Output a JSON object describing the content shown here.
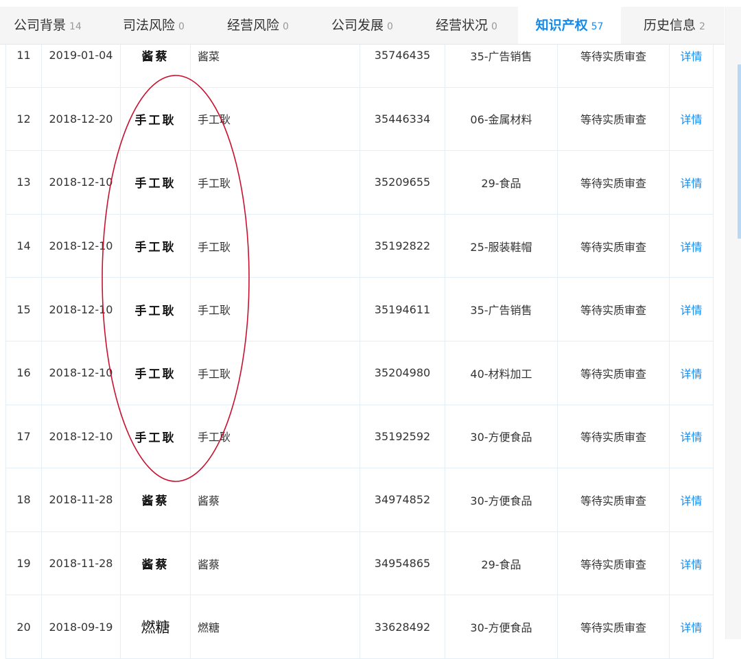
{
  "tabs": [
    {
      "label": "公司背景",
      "count": "14",
      "active": false
    },
    {
      "label": "司法风险",
      "count": "0",
      "active": false
    },
    {
      "label": "经营风险",
      "count": "0",
      "active": false
    },
    {
      "label": "公司发展",
      "count": "0",
      "active": false
    },
    {
      "label": "经营状况",
      "count": "0",
      "active": false
    },
    {
      "label": "知识产权",
      "count": "57",
      "active": true
    },
    {
      "label": "历史信息",
      "count": "2",
      "active": false
    }
  ],
  "rows": [
    {
      "no": "11",
      "date": "2019-01-04",
      "logo": "酱蔡",
      "name": "酱菜",
      "reg_no": "35746435",
      "category": "35-广告销售",
      "status": "等待实质审查",
      "link": "详情"
    },
    {
      "no": "12",
      "date": "2018-12-20",
      "logo": "手工耿",
      "name": "手工耿",
      "reg_no": "35446334",
      "category": "06-金属材料",
      "status": "等待实质审查",
      "link": "详情"
    },
    {
      "no": "13",
      "date": "2018-12-10",
      "logo": "手工耿",
      "name": "手工耿",
      "reg_no": "35209655",
      "category": "29-食品",
      "status": "等待实质审查",
      "link": "详情"
    },
    {
      "no": "14",
      "date": "2018-12-10",
      "logo": "手工耿",
      "name": "手工耿",
      "reg_no": "35192822",
      "category": "25-服装鞋帽",
      "status": "等待实质审查",
      "link": "详情"
    },
    {
      "no": "15",
      "date": "2018-12-10",
      "logo": "手工耿",
      "name": "手工耿",
      "reg_no": "35194611",
      "category": "35-广告销售",
      "status": "等待实质审查",
      "link": "详情"
    },
    {
      "no": "16",
      "date": "2018-12-10",
      "logo": "手工耿",
      "name": "手工耿",
      "reg_no": "35204980",
      "category": "40-材料加工",
      "status": "等待实质审查",
      "link": "详情"
    },
    {
      "no": "17",
      "date": "2018-12-10",
      "logo": "手工耿",
      "name": "手工耿",
      "reg_no": "35192592",
      "category": "30-方便食品",
      "status": "等待实质审查",
      "link": "详情"
    },
    {
      "no": "18",
      "date": "2018-11-28",
      "logo": "酱蔡",
      "name": "酱蔡",
      "reg_no": "34974852",
      "category": "30-方便食品",
      "status": "等待实质审查",
      "link": "详情"
    },
    {
      "no": "19",
      "date": "2018-11-28",
      "logo": "酱蔡",
      "name": "酱蔡",
      "reg_no": "34954865",
      "category": "29-食品",
      "status": "等待实质审查",
      "link": "详情"
    },
    {
      "no": "20",
      "date": "2018-09-19",
      "logo": "燃糖",
      "name": "燃糖",
      "reg_no": "33628492",
      "category": "30-方便食品",
      "status": "等待实质审查",
      "link": "详情"
    }
  ],
  "colors": {
    "accent": "#128bed",
    "annotation": "#c8102e"
  }
}
